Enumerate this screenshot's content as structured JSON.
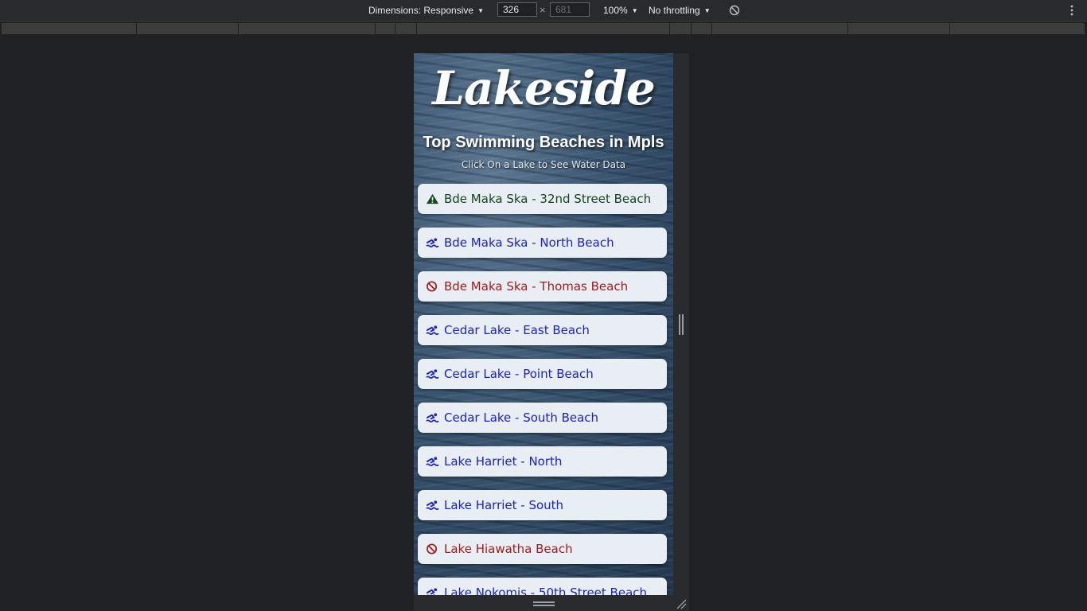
{
  "toolbar": {
    "dimensions_label": "Dimensions: Responsive",
    "width_value": "326",
    "height_placeholder": "681",
    "times": "×",
    "zoom": "100%",
    "throttling": "No throttling"
  },
  "page": {
    "logo": "Lakeside",
    "headline": "Top Swimming Beaches in Mpls",
    "subline": "Click On a Lake to See Water Data"
  },
  "colors": {
    "open": "#1b22c4",
    "advisory": "#14451b",
    "closed": "#a31b1b"
  },
  "beaches": [
    {
      "label": "Bde Maka Ska - 32nd Street Beach",
      "status": "advisory",
      "icon": "warning-triangle-icon"
    },
    {
      "label": "Bde Maka Ska - North Beach",
      "status": "open",
      "icon": "swimmer-icon"
    },
    {
      "label": "Bde Maka Ska - Thomas Beach",
      "status": "closed",
      "icon": "ban-icon"
    },
    {
      "label": "Cedar Lake - East Beach",
      "status": "open",
      "icon": "swimmer-icon"
    },
    {
      "label": "Cedar Lake - Point Beach",
      "status": "open",
      "icon": "swimmer-icon"
    },
    {
      "label": "Cedar Lake - South Beach",
      "status": "open",
      "icon": "swimmer-icon"
    },
    {
      "label": "Lake Harriet - North",
      "status": "open",
      "icon": "swimmer-icon"
    },
    {
      "label": "Lake Harriet - South",
      "status": "open",
      "icon": "swimmer-icon"
    },
    {
      "label": "Lake Hiawatha Beach",
      "status": "closed",
      "icon": "ban-icon"
    },
    {
      "label": "Lake Nokomis - 50th Street Beach",
      "status": "open",
      "icon": "swimmer-icon"
    }
  ]
}
